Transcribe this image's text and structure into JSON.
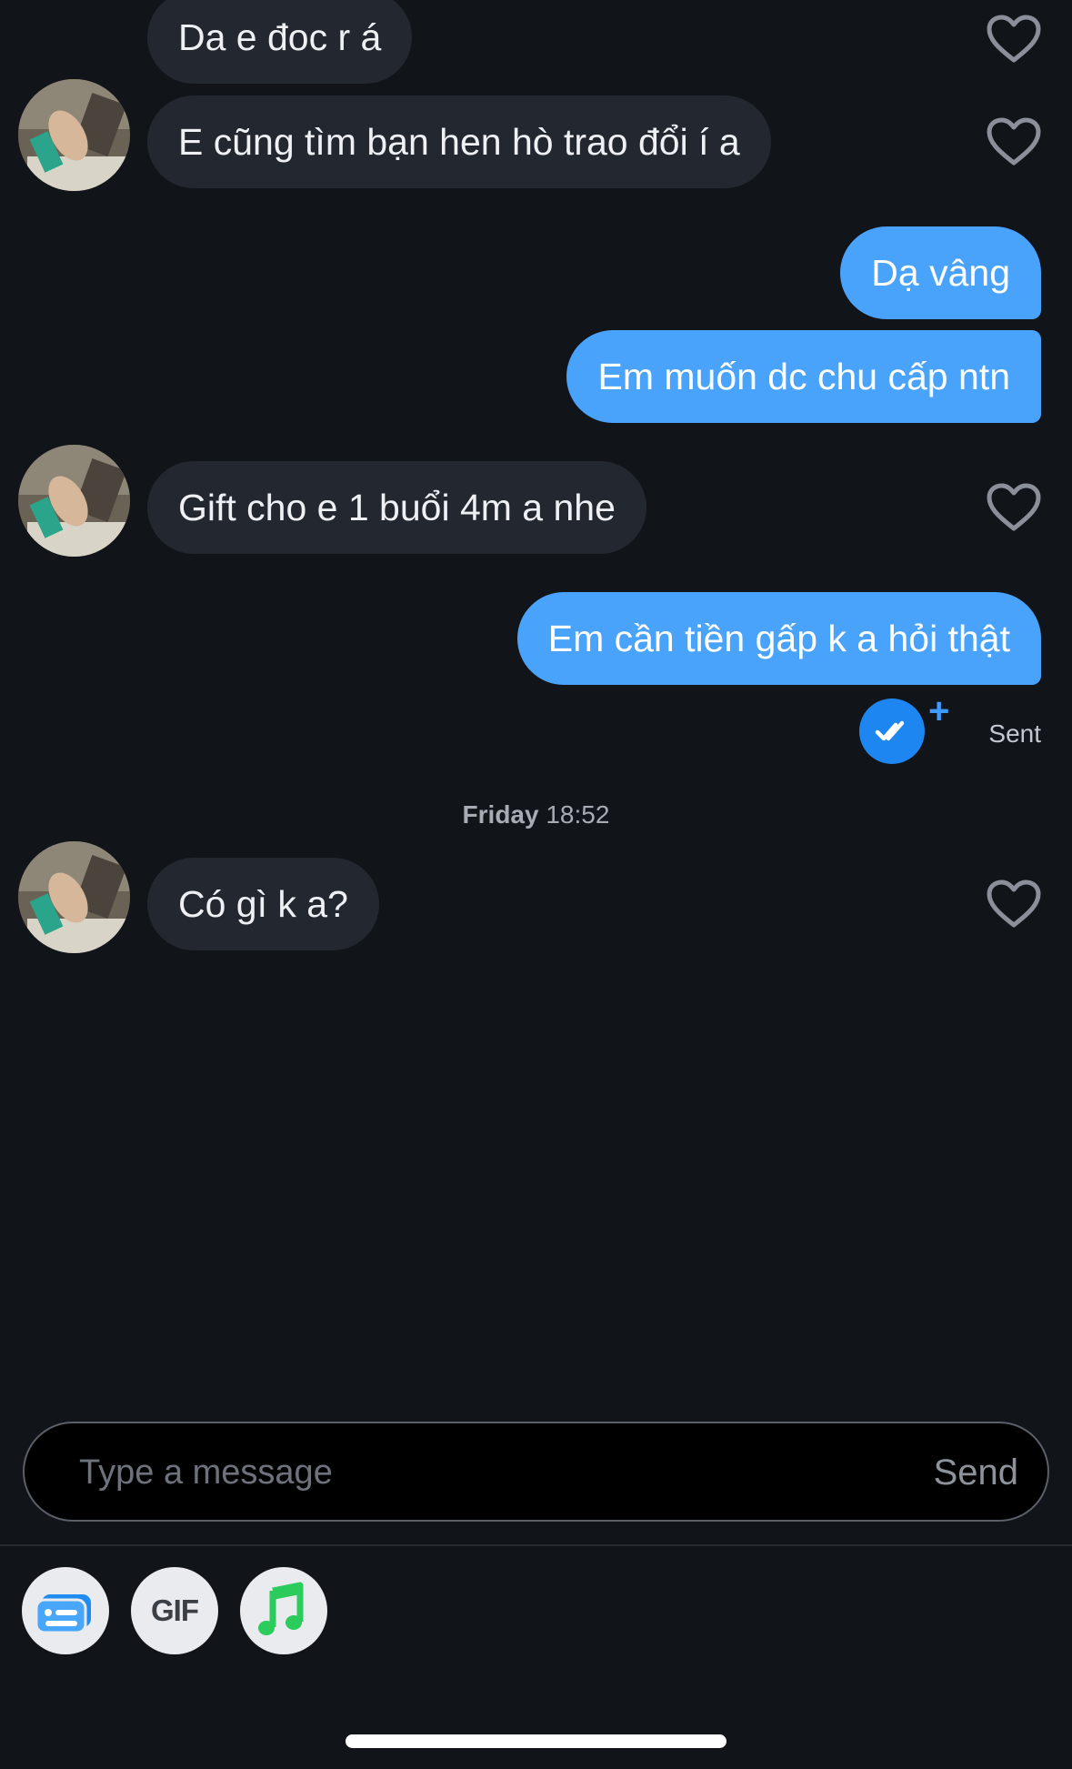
{
  "messages": [
    {
      "text": "Da e đoc r á"
    },
    {
      "text": "E cũng tìm bạn hen hò trao đổi í a"
    },
    {
      "text": "Dạ vâng"
    },
    {
      "text": "Em muốn dc chu cấp ntn"
    },
    {
      "text": "Gift cho e 1 buổi 4m a nhe"
    },
    {
      "text": "Em cần tiền gấp k a hỏi thật"
    },
    {
      "text": "Có gì k a?"
    }
  ],
  "status": {
    "sent_label": "Sent",
    "plus": "+"
  },
  "timestamp": {
    "day": "Friday",
    "time": "18:52"
  },
  "composer": {
    "placeholder": "Type a message",
    "send_label": "Send"
  },
  "toolbar": {
    "gif_label": "GIF"
  },
  "colors": {
    "background": "#111419",
    "incoming_bubble": "#232730",
    "outgoing_bubble": "#4aa3fb",
    "read_receipt": "#1d86f0",
    "music_icon": "#2bcb5c"
  },
  "icons": {
    "like": "heart-outline-icon",
    "read": "double-check-icon",
    "card": "id-card-icon",
    "music": "music-note-icon"
  }
}
